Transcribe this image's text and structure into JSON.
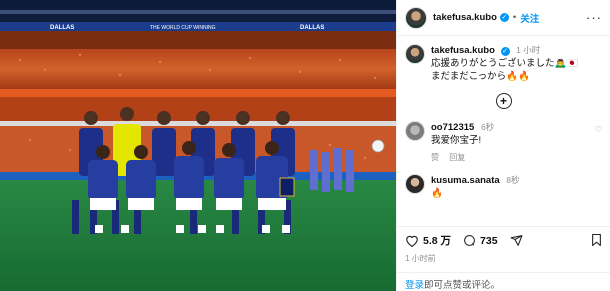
{
  "header": {
    "username": "takefusa.kubo",
    "follow_label": "关注",
    "more_label": "···"
  },
  "caption": {
    "username": "takefusa.kubo",
    "time": "1 小时",
    "line1": "応援ありがとうございました🙇‍♂️🇯🇵",
    "line2": "まだまだこっから🔥🔥"
  },
  "add_label": "+",
  "comments": [
    {
      "username": "oo712315",
      "time": "6秒",
      "text": "我爱你宝子!",
      "likes_label": "赞",
      "reply_label": "回复"
    },
    {
      "username": "kusuma.sanata",
      "time": "8秒",
      "text": "🔥"
    }
  ],
  "actions": {
    "likes": "5.8 万",
    "comments": "735"
  },
  "posted": "1 小时前",
  "login": {
    "link": "登录",
    "rest": "即可点赞或评论。"
  },
  "photo": {
    "banner_left": "DALLAS",
    "banner_mid": "THE WORLD CUP WINNING",
    "banner_right": "DALLAS",
    "team_colors": {
      "kit": "#1e2f8a",
      "keeper": "#e5e600",
      "pitch": "#1f7a3a",
      "crowd": "#c14b1d"
    }
  }
}
